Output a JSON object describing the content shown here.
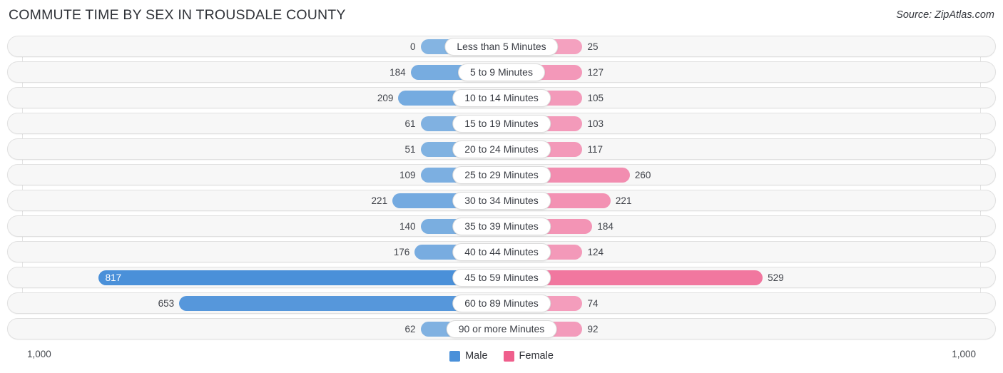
{
  "header": {
    "title": "COMMUTE TIME BY SEX IN TROUSDALE COUNTY",
    "source": "Source: ZipAtlas.com"
  },
  "axis": {
    "left_label": "1,000",
    "right_label": "1,000"
  },
  "legend": {
    "male_label": "Male",
    "female_label": "Female",
    "male_color": "#4a90d9",
    "female_color": "#ef5f8c"
  },
  "chart_data": {
    "type": "bar",
    "title": "COMMUTE TIME BY SEX IN TROUSDALE COUNTY",
    "subtitle": "Source: ZipAtlas.com",
    "orientation": "horizontal-diverging",
    "xlabel": "",
    "ylabel": "",
    "xlim": [
      -1000,
      1000
    ],
    "axis_tick_labels": [
      "1,000",
      "1,000"
    ],
    "grid": false,
    "legend_position": "bottom-center",
    "categories": [
      "Less than 5 Minutes",
      "5 to 9 Minutes",
      "10 to 14 Minutes",
      "15 to 19 Minutes",
      "20 to 24 Minutes",
      "25 to 29 Minutes",
      "30 to 34 Minutes",
      "35 to 39 Minutes",
      "40 to 44 Minutes",
      "45 to 59 Minutes",
      "60 to 89 Minutes",
      "90 or more Minutes"
    ],
    "series": [
      {
        "name": "Male",
        "color": "#4a90d9",
        "values": [
          0,
          184,
          209,
          61,
          51,
          109,
          221,
          140,
          176,
          817,
          653,
          62
        ]
      },
      {
        "name": "Female",
        "color": "#ef5f8c",
        "values": [
          25,
          127,
          105,
          103,
          117,
          260,
          221,
          184,
          124,
          529,
          74,
          92
        ]
      }
    ]
  },
  "rows": [
    {
      "category": "Less than 5 Minutes",
      "male": 0,
      "female": 25,
      "male_text": "0",
      "female_text": "25"
    },
    {
      "category": "5 to 9 Minutes",
      "male": 184,
      "female": 127,
      "male_text": "184",
      "female_text": "127"
    },
    {
      "category": "10 to 14 Minutes",
      "male": 209,
      "female": 105,
      "male_text": "209",
      "female_text": "105"
    },
    {
      "category": "15 to 19 Minutes",
      "male": 61,
      "female": 103,
      "male_text": "61",
      "female_text": "103"
    },
    {
      "category": "20 to 24 Minutes",
      "male": 51,
      "female": 117,
      "male_text": "51",
      "female_text": "117"
    },
    {
      "category": "25 to 29 Minutes",
      "male": 109,
      "female": 260,
      "male_text": "109",
      "female_text": "260"
    },
    {
      "category": "30 to 34 Minutes",
      "male": 221,
      "female": 221,
      "male_text": "221",
      "female_text": "221"
    },
    {
      "category": "35 to 39 Minutes",
      "male": 140,
      "female": 184,
      "male_text": "140",
      "female_text": "184"
    },
    {
      "category": "40 to 44 Minutes",
      "male": 176,
      "female": 124,
      "male_text": "176",
      "female_text": "124"
    },
    {
      "category": "45 to 59 Minutes",
      "male": 817,
      "female": 529,
      "male_text": "817",
      "female_text": "529"
    },
    {
      "category": "60 to 89 Minutes",
      "male": 653,
      "female": 74,
      "male_text": "653",
      "female_text": "74"
    },
    {
      "category": "90 or more Minutes",
      "male": 62,
      "female": 92,
      "male_text": "62",
      "female_text": "92"
    }
  ]
}
